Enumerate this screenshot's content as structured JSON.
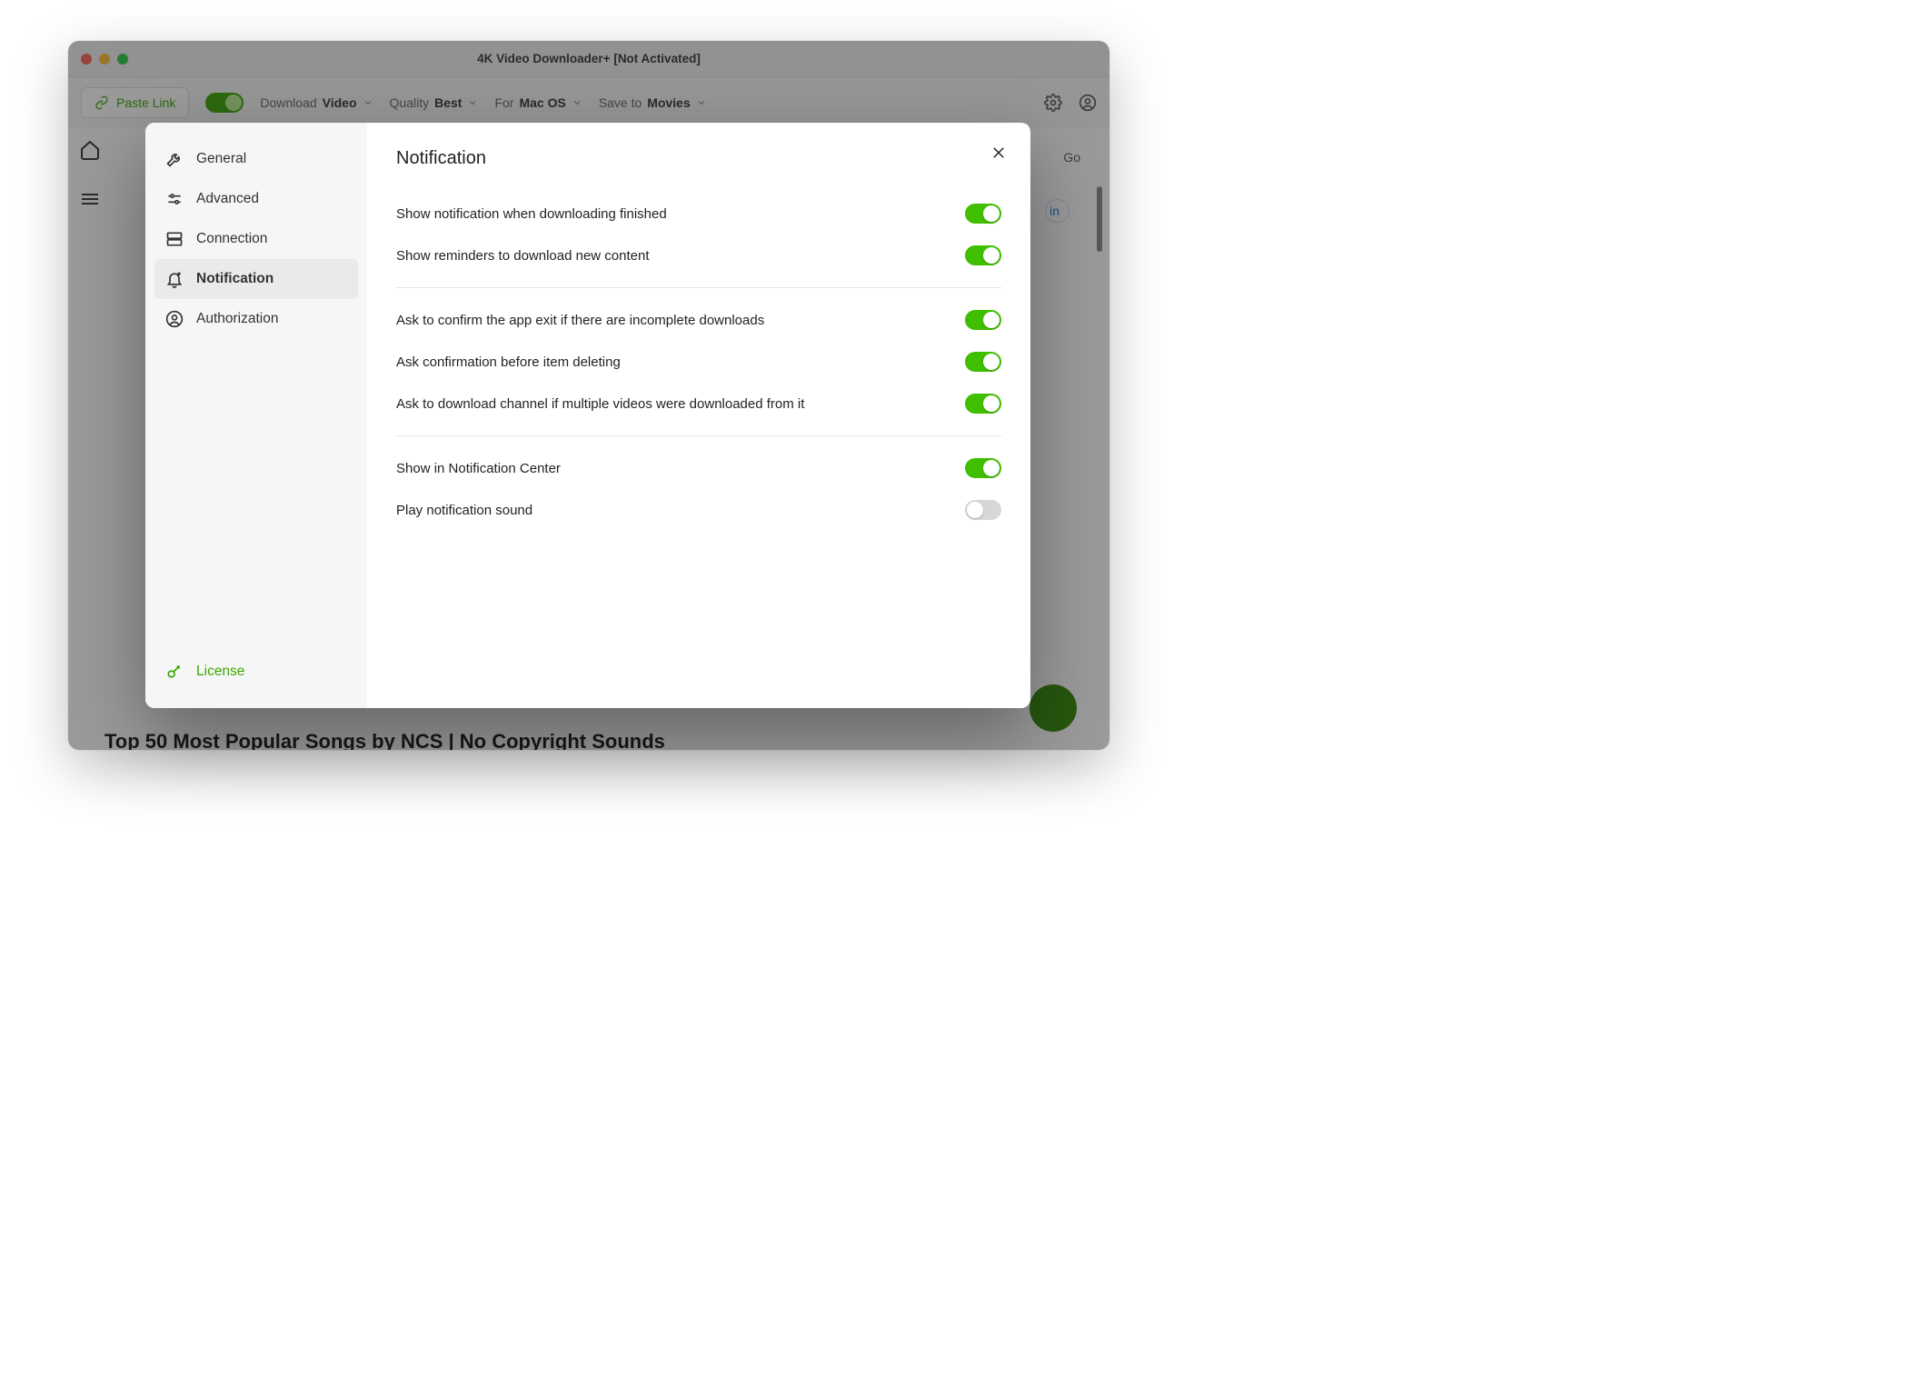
{
  "window": {
    "title": "4K Video Downloader+ [Not Activated]"
  },
  "toolbar": {
    "paste_link": "Paste Link",
    "download_label": "Download",
    "download_value": "Video",
    "quality_label": "Quality",
    "quality_value": "Best",
    "for_label": "For",
    "for_value": "Mac OS",
    "saveto_label": "Save to",
    "saveto_value": "Movies"
  },
  "addressbar": {
    "go": "Go"
  },
  "main": {
    "sign_in": "in",
    "video_title": "Top 50 Most Popular Songs by NCS | No Copyright Sounds"
  },
  "modal": {
    "title": "Notification",
    "sidebar": {
      "general": "General",
      "advanced": "Advanced",
      "connection": "Connection",
      "notification": "Notification",
      "authorization": "Authorization",
      "license": "License"
    },
    "settings": {
      "g1": [
        {
          "label": "Show notification when downloading finished",
          "on": true
        },
        {
          "label": "Show reminders to download new content",
          "on": true
        }
      ],
      "g2": [
        {
          "label": "Ask to confirm the app exit if there are incomplete downloads",
          "on": true
        },
        {
          "label": "Ask confirmation before item deleting",
          "on": true
        },
        {
          "label": "Ask to download channel if multiple videos were downloaded from it",
          "on": true
        }
      ],
      "g3": [
        {
          "label": "Show in Notification Center",
          "on": true
        },
        {
          "label": "Play notification sound",
          "on": false
        }
      ]
    }
  }
}
